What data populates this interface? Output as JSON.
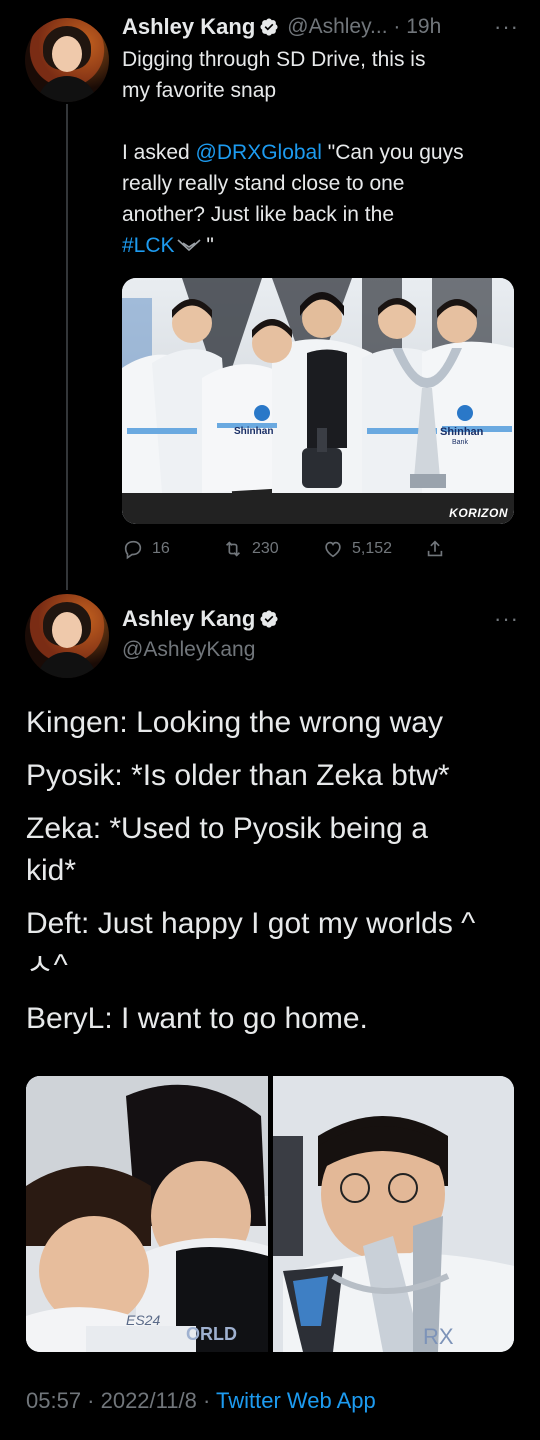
{
  "tweet1": {
    "name": "Ashley Kang",
    "handle_time": "@Ashley... · 19h",
    "more": "···",
    "line1": "Digging through SD Drive, this is",
    "line2": "my favorite snap",
    "p2_line1_pre": "I asked ",
    "p2_mention": "@DRXGlobal",
    "p2_line1_post": " \"Can you guys",
    "p2_line2": "really really stand close to one",
    "p2_line3": "another? Just like back in the",
    "p2_hashtag": "#LCK",
    "p2_line4_post": " \"",
    "photo_watermark": "KORIZON",
    "photo_sponsor": "Shinhan",
    "photo_sponsor_sub": "Bank",
    "actions": {
      "replies": "16",
      "retweets": "230",
      "likes": "5,152"
    }
  },
  "tweet2": {
    "name": "Ashley Kang",
    "handle": "@AshleyKang",
    "more": "···",
    "lines": [
      "Kingen: Looking the wrong way",
      "Pyosik: *Is older than Zeka btw*",
      "Zeka: *Used to Pyosik being a",
      "kid*",
      "Deft: Just happy I got my worlds ^",
      "ㅅ^",
      "BeryL: I want to go home."
    ],
    "photo_left_text": "ES24",
    "photo_left_text2": "ORLD",
    "photo_right_text": "RX",
    "footer_time": "05:57 · 2022/11/8 · ",
    "footer_app": "Twitter Web App"
  },
  "colors": {
    "background": "#000000",
    "text": "#e7e9ea",
    "secondary": "#71767b",
    "accent": "#1d9bf0"
  }
}
